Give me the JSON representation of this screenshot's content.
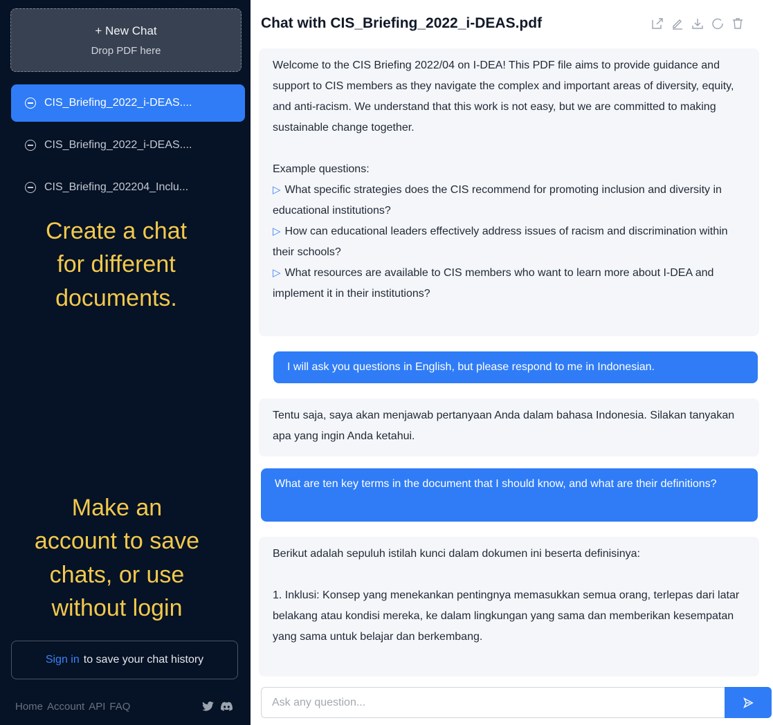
{
  "sidebar": {
    "new_chat": {
      "title": "+ New Chat",
      "subtitle": "Drop PDF here"
    },
    "chats": [
      {
        "label": "CIS_Briefing_2022_i-DEAS...."
      },
      {
        "label": "CIS_Briefing_2022_i-DEAS...."
      },
      {
        "label": "CIS_Briefing_202204_Inclu..."
      }
    ],
    "promo_top": [
      "Create a chat",
      "for different",
      "documents."
    ],
    "promo_bottom": [
      "Make an",
      "account to save",
      "chats, or use",
      "without login"
    ],
    "signin": {
      "link": "Sign in",
      "text": "to save your chat history"
    },
    "footer": {
      "home": "Home",
      "account": "Account",
      "api": "API",
      "faq": "FAQ"
    },
    "social_icons": [
      "twitter-icon",
      "discord-icon"
    ]
  },
  "header": {
    "title": "Chat with CIS_Briefing_2022_i-DEAS.pdf",
    "tools": [
      "share-icon",
      "edit-icon",
      "download-icon",
      "reset-icon",
      "trash-icon"
    ]
  },
  "messages": {
    "welcome": {
      "intro": "Welcome to the CIS Briefing 2022/04 on I-DEA! This PDF file aims to provide guidance and support to CIS members as they navigate the complex and important areas of diversity, equity, and anti-racism. We understand that this work is not easy, but we are committed to making sustainable change together.",
      "examples_label": "Example questions:",
      "questions": [
        "What specific strategies does the CIS recommend for promoting inclusion and diversity in educational institutions?",
        "How can educational leaders effectively address issues of racism and discrimination within their schools?",
        "What resources are available to CIS members who want to learn more about I-DEA and implement it in their institutions?"
      ]
    },
    "user1": "I will ask you questions in English, but please respond to me in Indonesian.",
    "bot1": "Tentu saja, saya akan menjawab pertanyaan Anda dalam bahasa Indonesia. Silakan tanyakan apa yang ingin Anda ketahui.",
    "user2": "What are ten key terms in the document that I should know, and what are their definitions?",
    "bot2": {
      "intro": "Berikut adalah sepuluh istilah kunci dalam dokumen ini beserta definisinya:",
      "item1": "1. Inklusi: Konsep yang menekankan pentingnya memasukkan semua orang, terlepas dari latar belakang atau kondisi mereka, ke dalam lingkungan yang sama dan memberikan kesempatan yang sama untuk belajar dan berkembang."
    }
  },
  "input": {
    "placeholder": "Ask any question..."
  },
  "colors": {
    "accent": "#2f7cf6",
    "sidebar_bg": "#061226",
    "promo": "#f2c94c"
  }
}
